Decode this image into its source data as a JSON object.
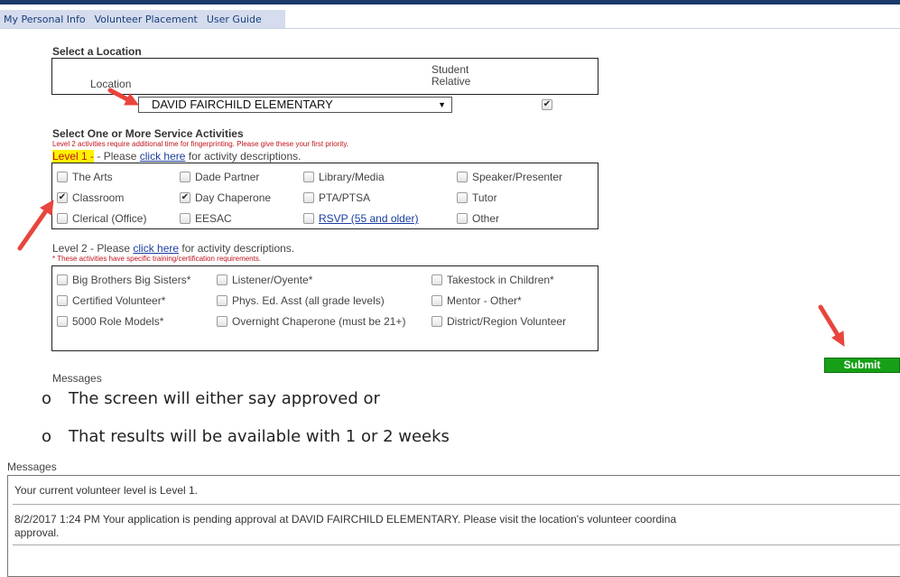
{
  "nav": {
    "items": [
      "My Personal Info",
      "Volunteer Placement",
      "User Guide"
    ]
  },
  "location": {
    "heading": "Select a Location",
    "col_location": "Location",
    "col_student_relative_1": "Student",
    "col_student_relative_2": "Relative",
    "selected": "DAVID FAIRCHILD ELEMENTARY",
    "student_relative_checked": true
  },
  "activities": {
    "heading": "Select One or More Service Activities",
    "note": "Level 2 activities require additional time for fingerprinting. Please give these your first priority.",
    "level1_prefix": "Level 1",
    "level1_dash": " - Please ",
    "click_here": "click here",
    "level1_suffix": " for activity descriptions.",
    "level1_items": [
      {
        "label": "The Arts",
        "checked": false
      },
      {
        "label": "Dade Partner",
        "checked": false
      },
      {
        "label": "Library/Media",
        "checked": false
      },
      {
        "label": "Speaker/Presenter",
        "checked": false
      },
      {
        "label": "Classroom",
        "checked": true
      },
      {
        "label": "Day Chaperone",
        "checked": true
      },
      {
        "label": "PTA/PTSA",
        "checked": false
      },
      {
        "label": "Tutor",
        "checked": false
      },
      {
        "label": "Clerical (Office)",
        "checked": false
      },
      {
        "label": "EESAC",
        "checked": false
      },
      {
        "label": "RSVP (55 and older)",
        "checked": false
      },
      {
        "label": "Other",
        "checked": false
      }
    ],
    "level2_prefix": "Level 2 - Please ",
    "level2_suffix": " for activity descriptions.",
    "level2_note": "* These activities have specific training/certification requirements.",
    "level2_items": [
      {
        "label": "Big Brothers Big Sisters*",
        "checked": false
      },
      {
        "label": "Listener/Oyente*",
        "checked": false
      },
      {
        "label": "Takestock in Children*",
        "checked": false
      },
      {
        "label": "Certified Volunteer*",
        "checked": false
      },
      {
        "label": "Phys. Ed. Asst (all grade levels)",
        "checked": false
      },
      {
        "label": "Mentor - Other*",
        "checked": false
      },
      {
        "label": "5000 Role Models*",
        "checked": false
      },
      {
        "label": "Overnight Chaperone (must be 21+)",
        "checked": false
      },
      {
        "label": "District/Region Volunteer",
        "checked": false
      }
    ]
  },
  "submit_label": "Submit",
  "messages_label_1": "Messages",
  "bullets": [
    "The screen will either say approved or",
    "That results will be available with 1 or 2 weeks"
  ],
  "bullet_marker": "o",
  "messages_label_2": "Messages",
  "messages": {
    "line1": "Your current volunteer level is Level 1.",
    "line2": "8/2/2017 1:24 PM Your application is pending approval at DAVID FAIRCHILD ELEMENTARY. Please visit the location's volunteer coordina",
    "line3": "approval."
  },
  "colors": {
    "accent_green": "#17a017",
    "arrow_red": "#e8453c",
    "highlight_yellow": "#fff200",
    "nav_bg": "#d4dced"
  }
}
